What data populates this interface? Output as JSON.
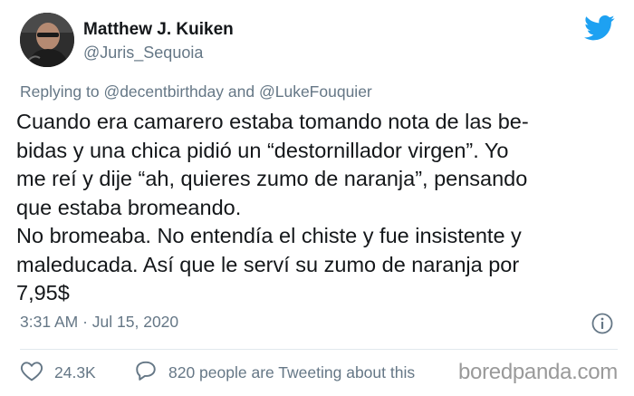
{
  "author": {
    "display_name": "Matthew J. Kuiken",
    "handle": "@Juris_Sequoia"
  },
  "reply": {
    "prefix": "Replying to",
    "mention_1": "@decentbirthday",
    "conjunction": "and",
    "mention_2": "@LukeFouquier"
  },
  "tweet": {
    "lines": [
      "Cuando era camarero estaba tomando nota de las be-",
      "bidas y una chica pidió un “destornillador virgen”. Yo",
      "me reí y dije “ah, quieres zumo de naranja”, pensando",
      "que estaba bromeando.",
      "No bromeaba. No entendía el chiste y fue insistente y",
      "maleducada. Así que le serví su zumo de naranja por",
      "7,95$"
    ]
  },
  "meta": {
    "time": "3:31 AM",
    "separator": "·",
    "date": "Jul 15, 2020"
  },
  "actions": {
    "likes": "24.3K",
    "conversation": "820 people are Tweeting about this"
  },
  "watermark": {
    "text": "boredpanda.com"
  },
  "icons": {
    "brand": "twitter-bird-icon",
    "info": "info-icon",
    "like": "heart-icon",
    "reply": "speech-bubble-icon"
  },
  "colors": {
    "twitter_blue": "#1da1f2",
    "secondary_text": "#657786",
    "primary_text": "#14171a"
  }
}
